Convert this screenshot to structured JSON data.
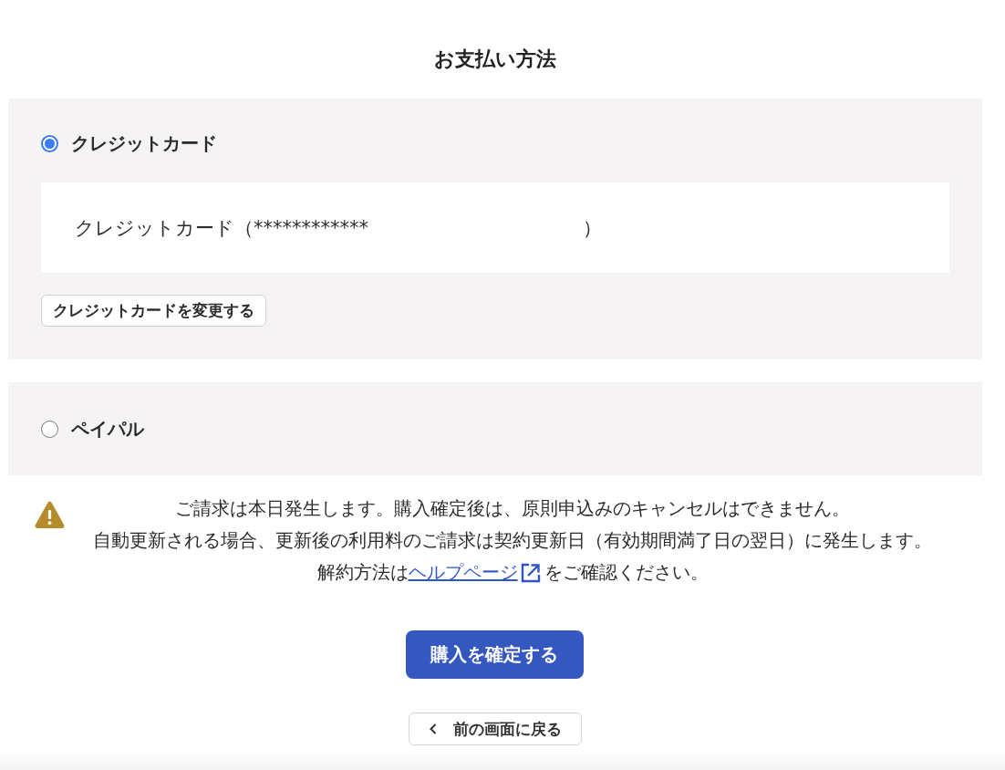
{
  "page": {
    "title": "お支払い方法"
  },
  "payment_methods": [
    {
      "kind": "card",
      "label": "クレジットカード",
      "selected": true,
      "card_text": "クレジットカード（************",
      "card_text_end": "）",
      "change_button": "クレジットカードを変更する"
    },
    {
      "kind": "simple",
      "label": "ペイパル",
      "selected": false
    }
  ],
  "notice": {
    "lines": [
      "ご請求は本日発生します。購入確定後は、原則申込みのキャンセルはできません。",
      "自動更新される場合、更新後の利用料のご請求は契約更新日（有効期間満了日の翌日）に発生します。"
    ],
    "help_line": {
      "before": "解約方法は",
      "link": "ヘルプページ",
      "after": "をご確認ください。"
    }
  },
  "confirm_button": "購入を確定する",
  "back_button": "前の画面に戻る"
}
